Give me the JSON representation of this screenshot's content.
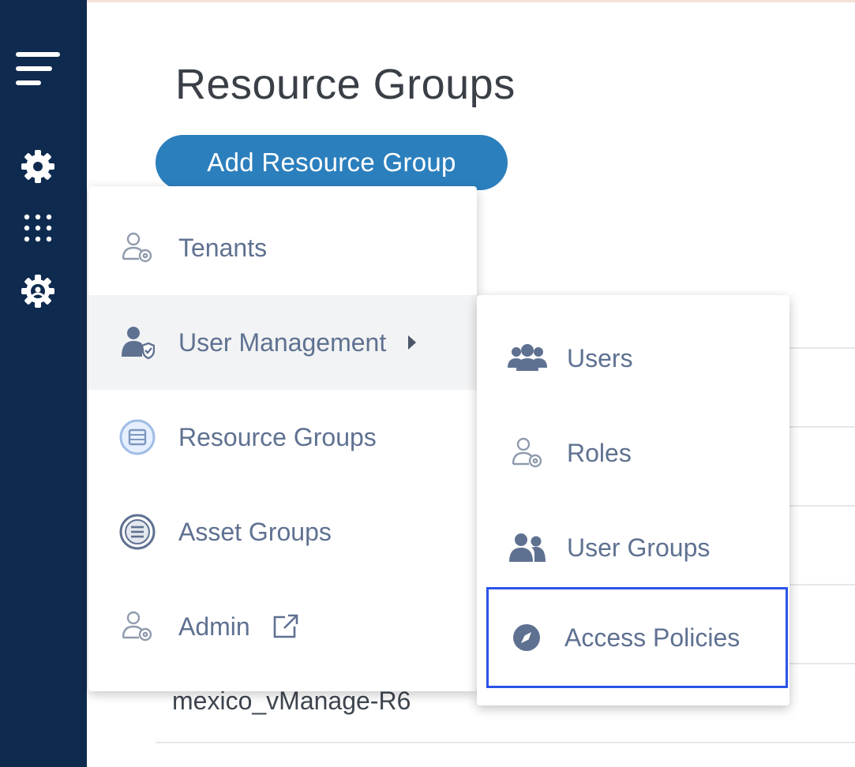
{
  "page": {
    "title": "Resource Groups",
    "add_button_label": "Add Resource Group",
    "background_row_text": "mexico_vManage-R6"
  },
  "rail": {
    "icons": [
      "menu-icon",
      "gear-icon",
      "apps-grid-icon",
      "settings-badge-icon"
    ]
  },
  "menu": {
    "items": [
      {
        "label": "Tenants",
        "icon": "tenant-icon"
      },
      {
        "label": "User Management",
        "icon": "user-shield-icon",
        "has_submenu": true,
        "active": true
      },
      {
        "label": "Resource Groups",
        "icon": "resource-group-icon"
      },
      {
        "label": "Asset Groups",
        "icon": "asset-group-icon"
      },
      {
        "label": "Admin",
        "icon": "admin-icon",
        "external": true
      }
    ]
  },
  "submenu": {
    "items": [
      {
        "label": "Users",
        "icon": "users-icon"
      },
      {
        "label": "Roles",
        "icon": "roles-icon"
      },
      {
        "label": "User Groups",
        "icon": "user-groups-icon"
      },
      {
        "label": "Access Policies",
        "icon": "compass-icon",
        "highlighted": true
      }
    ]
  },
  "colors": {
    "rail": "#0e2a4f",
    "primary_button": "#2b7fbd",
    "menu_text": "#5f7191",
    "highlight_border": "#2a54e8"
  }
}
